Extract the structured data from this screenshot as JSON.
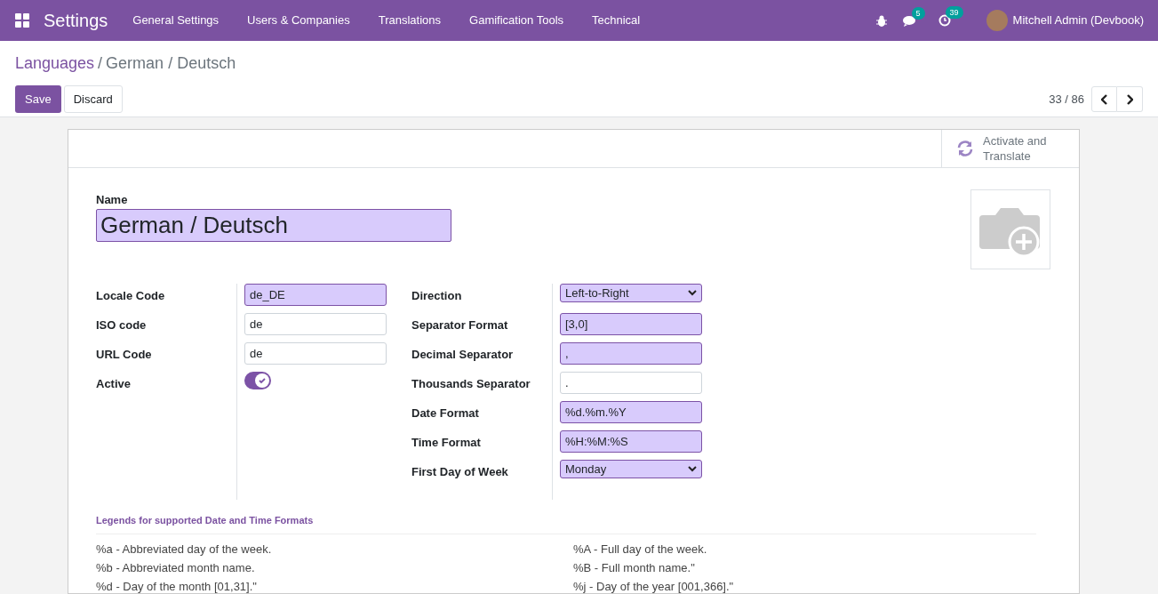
{
  "navbar": {
    "app_title": "Settings",
    "menu": [
      "General Settings",
      "Users & Companies",
      "Translations",
      "Gamification Tools",
      "Technical"
    ],
    "messages_badge": "5",
    "activities_badge": "39",
    "user": "Mitchell Admin (Devbook)"
  },
  "breadcrumb": {
    "parent": "Languages",
    "separator": "/",
    "current": "German / Deutsch"
  },
  "buttons": {
    "save": "Save",
    "discard": "Discard"
  },
  "pager": {
    "text": "33 / 86"
  },
  "sheet": {
    "action_button": "Activate and Translate",
    "name_label": "Name",
    "name_value": "German / Deutsch",
    "left_fields": [
      {
        "kind": "input",
        "label": "Locale Code",
        "value": "de_DE",
        "required": true
      },
      {
        "kind": "input",
        "label": "ISO code",
        "value": "de",
        "required": false
      },
      {
        "kind": "input",
        "label": "URL Code",
        "value": "de",
        "required": false
      },
      {
        "kind": "toggle",
        "label": "Active",
        "on": true
      }
    ],
    "right_fields": [
      {
        "kind": "select",
        "label": "Direction",
        "value": "Left-to-Right",
        "required": true
      },
      {
        "kind": "input",
        "label": "Separator Format",
        "value": "[3,0]",
        "required": true
      },
      {
        "kind": "input",
        "label": "Decimal Separator",
        "value": ",",
        "required": true
      },
      {
        "kind": "input",
        "label": "Thousands Separator",
        "value": ".",
        "required": false
      },
      {
        "kind": "input",
        "label": "Date Format",
        "value": "%d.%m.%Y",
        "required": true
      },
      {
        "kind": "input",
        "label": "Time Format",
        "value": "%H:%M:%S",
        "required": true
      },
      {
        "kind": "select",
        "label": "First Day of Week",
        "value": "Monday",
        "required": true
      }
    ],
    "legend_title": "Legends for supported Date and Time Formats",
    "legend_left": [
      "%a - Abbreviated day of the week.",
      "%b - Abbreviated month name.",
      "%d - Day of the month [01,31].\""
    ],
    "legend_right": [
      "%A - Full day of the week.",
      "%B - Full month name.\"",
      "%j - Day of the year [001,366].\""
    ]
  }
}
